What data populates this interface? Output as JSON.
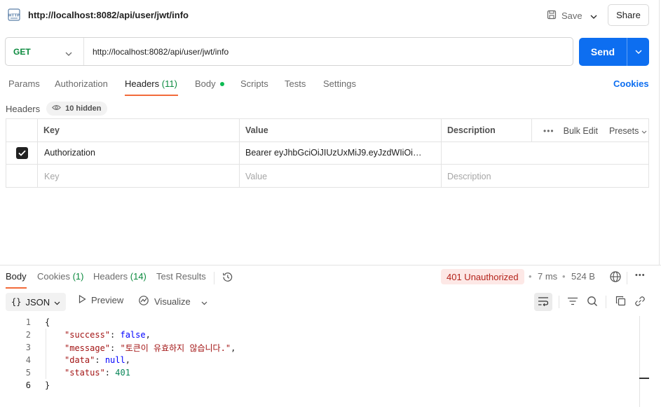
{
  "request": {
    "title": "http://localhost:8082/api/user/jwt/info",
    "save_label": "Save",
    "share_label": "Share",
    "method": "GET",
    "url": "http://localhost:8082/api/user/jwt/info",
    "send_label": "Send"
  },
  "request_tabs": {
    "params": "Params",
    "authorization": "Authorization",
    "headers_label": "Headers",
    "headers_count": "(11)",
    "body": "Body",
    "scripts": "Scripts",
    "tests": "Tests",
    "settings": "Settings",
    "cookies": "Cookies"
  },
  "headers_section": {
    "label": "Headers",
    "hidden_label": "10 hidden",
    "columns": {
      "key": "Key",
      "value": "Value",
      "description": "Description"
    },
    "bulk_edit": "Bulk Edit",
    "presets": "Presets",
    "rows": [
      {
        "key": "Authorization",
        "value": "Bearer  eyJhbGciOiJIUzUxMiJ9.eyJzdWIiOi…",
        "description": "",
        "checked": true
      }
    ],
    "placeholders": {
      "key": "Key",
      "value": "Value",
      "description": "Description"
    }
  },
  "response_tabs": {
    "body": "Body",
    "cookies_label": "Cookies",
    "cookies_count": "(1)",
    "headers_label": "Headers",
    "headers_count": "(14)",
    "test_results": "Test Results"
  },
  "response_meta": {
    "status": "401 Unauthorized",
    "time": "7 ms",
    "size": "524 B",
    "status_color": "#b4231b"
  },
  "response_toolbar": {
    "format": "JSON",
    "preview": "Preview",
    "visualize": "Visualize"
  },
  "response_body": {
    "line_numbers": [
      "1",
      "2",
      "3",
      "4",
      "5",
      "6"
    ],
    "open_brace": "{",
    "close_brace": "}",
    "success_key": "\"success\"",
    "success_value": "false",
    "message_key": "\"message\"",
    "message_value": "\"토큰이 유효하지 않습니다.\"",
    "data_key": "\"data\"",
    "data_value": "null",
    "status_key": "\"status\"",
    "status_value": "401"
  },
  "colors": {
    "accent": "#0d6ef0",
    "method_get": "#0b8a3e",
    "active_tab_underline": "#f26b3a"
  }
}
